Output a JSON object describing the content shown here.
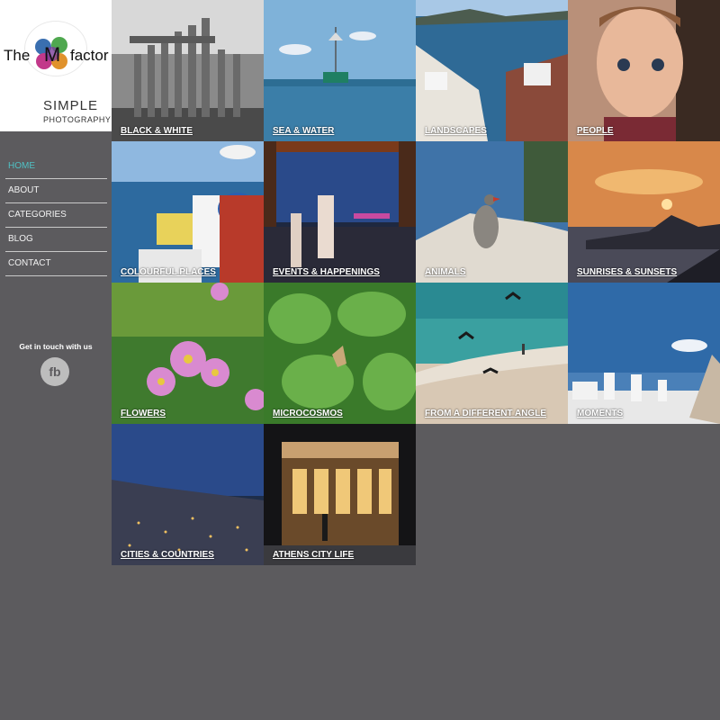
{
  "logo": {
    "the": "The",
    "m": "M",
    "factor": "factor",
    "simple": "SIMPLE",
    "photography": "PHOTOGRAPHY"
  },
  "nav": {
    "items": [
      {
        "label": "HOME"
      },
      {
        "label": "ABOUT"
      },
      {
        "label": "CATEGORIES"
      },
      {
        "label": "BLOG"
      },
      {
        "label": "CONTACT"
      }
    ],
    "active_color": "#4fc1c4"
  },
  "contact": {
    "title": "Get in touch with us",
    "fb_label": "fb"
  },
  "gallery": {
    "tiles": [
      {
        "label": "BLACK & WHITE"
      },
      {
        "label": "SEA & WATER"
      },
      {
        "label": "LANDSCAPES"
      },
      {
        "label": "PEOPLE"
      },
      {
        "label": "COLOURFUL PLACES"
      },
      {
        "label": "EVENTS & HAPPENINGS"
      },
      {
        "label": "ANIMALS"
      },
      {
        "label": "SUNRISES & SUNSETS"
      },
      {
        "label": "FLOWERS"
      },
      {
        "label": "MICROCOSMOS"
      },
      {
        "label": "FROM A DIFFERENT ANGLE"
      },
      {
        "label": "MOMENTS"
      },
      {
        "label": "CITIES & COUNTRIES"
      },
      {
        "label": "ATHENS CITY LIFE"
      }
    ]
  },
  "colors": {
    "background": "#5c5b5e",
    "accent": "#4fc1c4"
  }
}
